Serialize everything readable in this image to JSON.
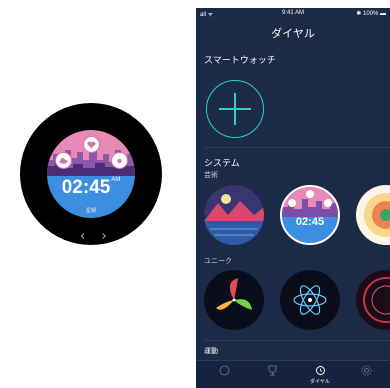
{
  "watch": {
    "time": "02:45",
    "ampm": "AM",
    "date": "星期",
    "nav": "‹ ›"
  },
  "phone": {
    "status": {
      "left": "all ᯤ",
      "time": "9:41 AM",
      "right": "✱ 100% ▬"
    },
    "title": "ダイヤル",
    "smartwatch_label": "スマートウォッチ",
    "system_label": "システム",
    "art_label": "芸術",
    "unique_label": "ユニーク",
    "exercise_label": "運動",
    "thumb_time": "02:45",
    "tabs": [
      {
        "label": "",
        "icon": "smile-icon",
        "active": false
      },
      {
        "label": "",
        "icon": "trophy-icon",
        "active": false
      },
      {
        "label": "ダイヤル",
        "icon": "watch-icon",
        "active": true
      },
      {
        "label": "",
        "icon": "settings-icon",
        "active": false
      }
    ]
  },
  "colors": {
    "accent": "#2fd0c0",
    "phone_bg": "#1b2a46",
    "face_pink": "#e88ab7",
    "face_blue": "#3c8ee0"
  }
}
